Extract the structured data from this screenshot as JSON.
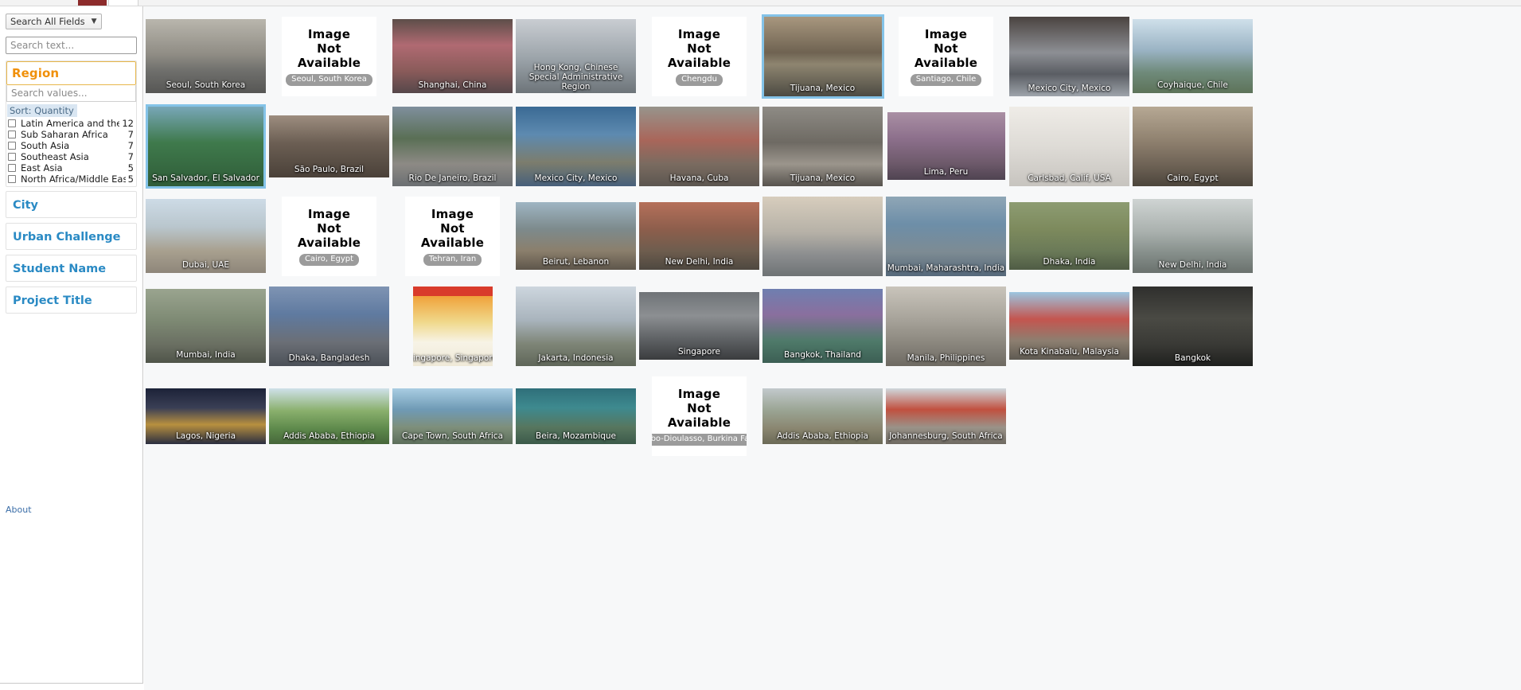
{
  "sidebar": {
    "field_select": {
      "label": "Search All Fields",
      "chevron": "chevron-down-icon"
    },
    "search_text_placeholder": "Search text...",
    "region_filter": {
      "title": "Region",
      "values_placeholder": "Search values...",
      "sort_label": "Sort: Quantity",
      "values": [
        {
          "label": "Latin America and the Caribbean",
          "count": "12"
        },
        {
          "label": "Sub Saharan Africa",
          "count": "7"
        },
        {
          "label": "South Asia",
          "count": "7"
        },
        {
          "label": "Southeast Asia",
          "count": "7"
        },
        {
          "label": "East Asia",
          "count": "5"
        },
        {
          "label": "North Africa/Middle East",
          "count": "5"
        }
      ]
    },
    "collapsed_filters": [
      {
        "title": "City"
      },
      {
        "title": "Urban Challenge"
      },
      {
        "title": "Student Name"
      },
      {
        "title": "Project Title"
      }
    ],
    "about_label": "About"
  },
  "gallery": {
    "rows": [
      [
        {
          "caption": "Seoul, South Korea",
          "type": "photo",
          "style": "seoul"
        },
        {
          "caption": "Seoul, South Korea",
          "type": "na"
        },
        {
          "caption": "Shanghai, China",
          "type": "photo",
          "style": "shanghai"
        },
        {
          "caption": "Hong Kong, Chinese Special Administrative Region",
          "type": "photo",
          "style": "hongkong",
          "two_line": true
        },
        {
          "caption": "Chengdu",
          "type": "na"
        },
        {
          "caption": "Tijuana, Mexico",
          "type": "photo",
          "style": "tijuana-collage",
          "selected": true
        },
        {
          "caption": "Santiago, Chile",
          "type": "na"
        },
        {
          "caption": "Mexico City, Mexico",
          "type": "photo",
          "style": "mexicocity-rain"
        },
        {
          "caption": "Coyhaique, Chile",
          "type": "photo",
          "style": "coyhaique"
        }
      ],
      [
        {
          "caption": "San Salvador, El Salvador",
          "type": "photo",
          "style": "sansalvador",
          "selected": true
        },
        {
          "caption": "São Paulo, Brazil",
          "type": "photo",
          "style": "saopaulo"
        },
        {
          "caption": "Rio De Janeiro, Brazil",
          "type": "photo",
          "style": "rio"
        },
        {
          "caption": "Mexico City, Mexico",
          "type": "photo",
          "style": "mexico-barrels"
        },
        {
          "caption": "Havana, Cuba",
          "type": "photo",
          "style": "havana"
        },
        {
          "caption": "Tijuana, Mexico",
          "type": "photo",
          "style": "tijuana-street"
        },
        {
          "caption": "Lima, Peru",
          "type": "photo",
          "style": "lima"
        },
        {
          "caption": "Carlsbad, Calif, USA",
          "type": "photo",
          "style": "carlsbad"
        },
        {
          "caption": "Cairo, Egypt",
          "type": "photo",
          "style": "cairo"
        }
      ],
      [
        {
          "caption": "Dubai, UAE",
          "type": "photo",
          "style": "dubai"
        },
        {
          "caption": "Cairo, Egypt",
          "type": "na"
        },
        {
          "caption": "Tehran, Iran",
          "type": "na"
        },
        {
          "caption": "Beirut, Lebanon",
          "type": "photo",
          "style": "beirut"
        },
        {
          "caption": "New Delhi, India",
          "type": "photo",
          "style": "newdelhi-houses"
        },
        {
          "caption": "",
          "type": "photo",
          "style": "skyline-hazy"
        },
        {
          "caption": "Mumbai, Maharashtra, India",
          "type": "photo",
          "style": "mumbai-aerial"
        },
        {
          "caption": "Dhaka, India",
          "type": "photo",
          "style": "dhaka-canal"
        },
        {
          "caption": "New Delhi, India",
          "type": "photo",
          "style": "newdelhi-smog"
        }
      ],
      [
        {
          "caption": "Mumbai, India",
          "type": "photo",
          "style": "mumbai-slum"
        },
        {
          "caption": "Dhaka, Bangladesh",
          "type": "photo",
          "style": "dhaka-train"
        },
        {
          "caption": "Singapore, Singapore",
          "type": "photo",
          "style": "singapore-poster"
        },
        {
          "caption": "Jakarta, Indonesia",
          "type": "photo",
          "style": "jakarta"
        },
        {
          "caption": "Singapore",
          "type": "photo",
          "style": "singapore-rain"
        },
        {
          "caption": "Bangkok, Thailand",
          "type": "photo",
          "style": "bangkok-park"
        },
        {
          "caption": "Manila, Philippines",
          "type": "photo",
          "style": "manila"
        },
        {
          "caption": "Kota Kinabalu, Malaysia",
          "type": "photo",
          "style": "kotakinabalu"
        },
        {
          "caption": "Bangkok",
          "type": "photo",
          "style": "bangkok-dark"
        }
      ],
      [
        {
          "caption": "Lagos, Nigeria",
          "type": "photo",
          "style": "lagos"
        },
        {
          "caption": "Addis Ababa, Ethiopia",
          "type": "photo",
          "style": "addis-park"
        },
        {
          "caption": "Cape Town, South Africa",
          "type": "photo",
          "style": "capetown"
        },
        {
          "caption": "Beira, Mozambique",
          "type": "photo",
          "style": "beira"
        },
        {
          "caption": "Bobo-Dioulasso, Burkina Faso",
          "type": "na"
        },
        {
          "caption": "Addis Ababa, Ethiopia",
          "type": "photo",
          "style": "addis-hills"
        },
        {
          "caption": "Johannesburg, South Africa",
          "type": "photo",
          "style": "johannesburg"
        }
      ]
    ],
    "na_label_line1": "Image",
    "na_label_line2": "Not",
    "na_label_line3": "Available"
  }
}
